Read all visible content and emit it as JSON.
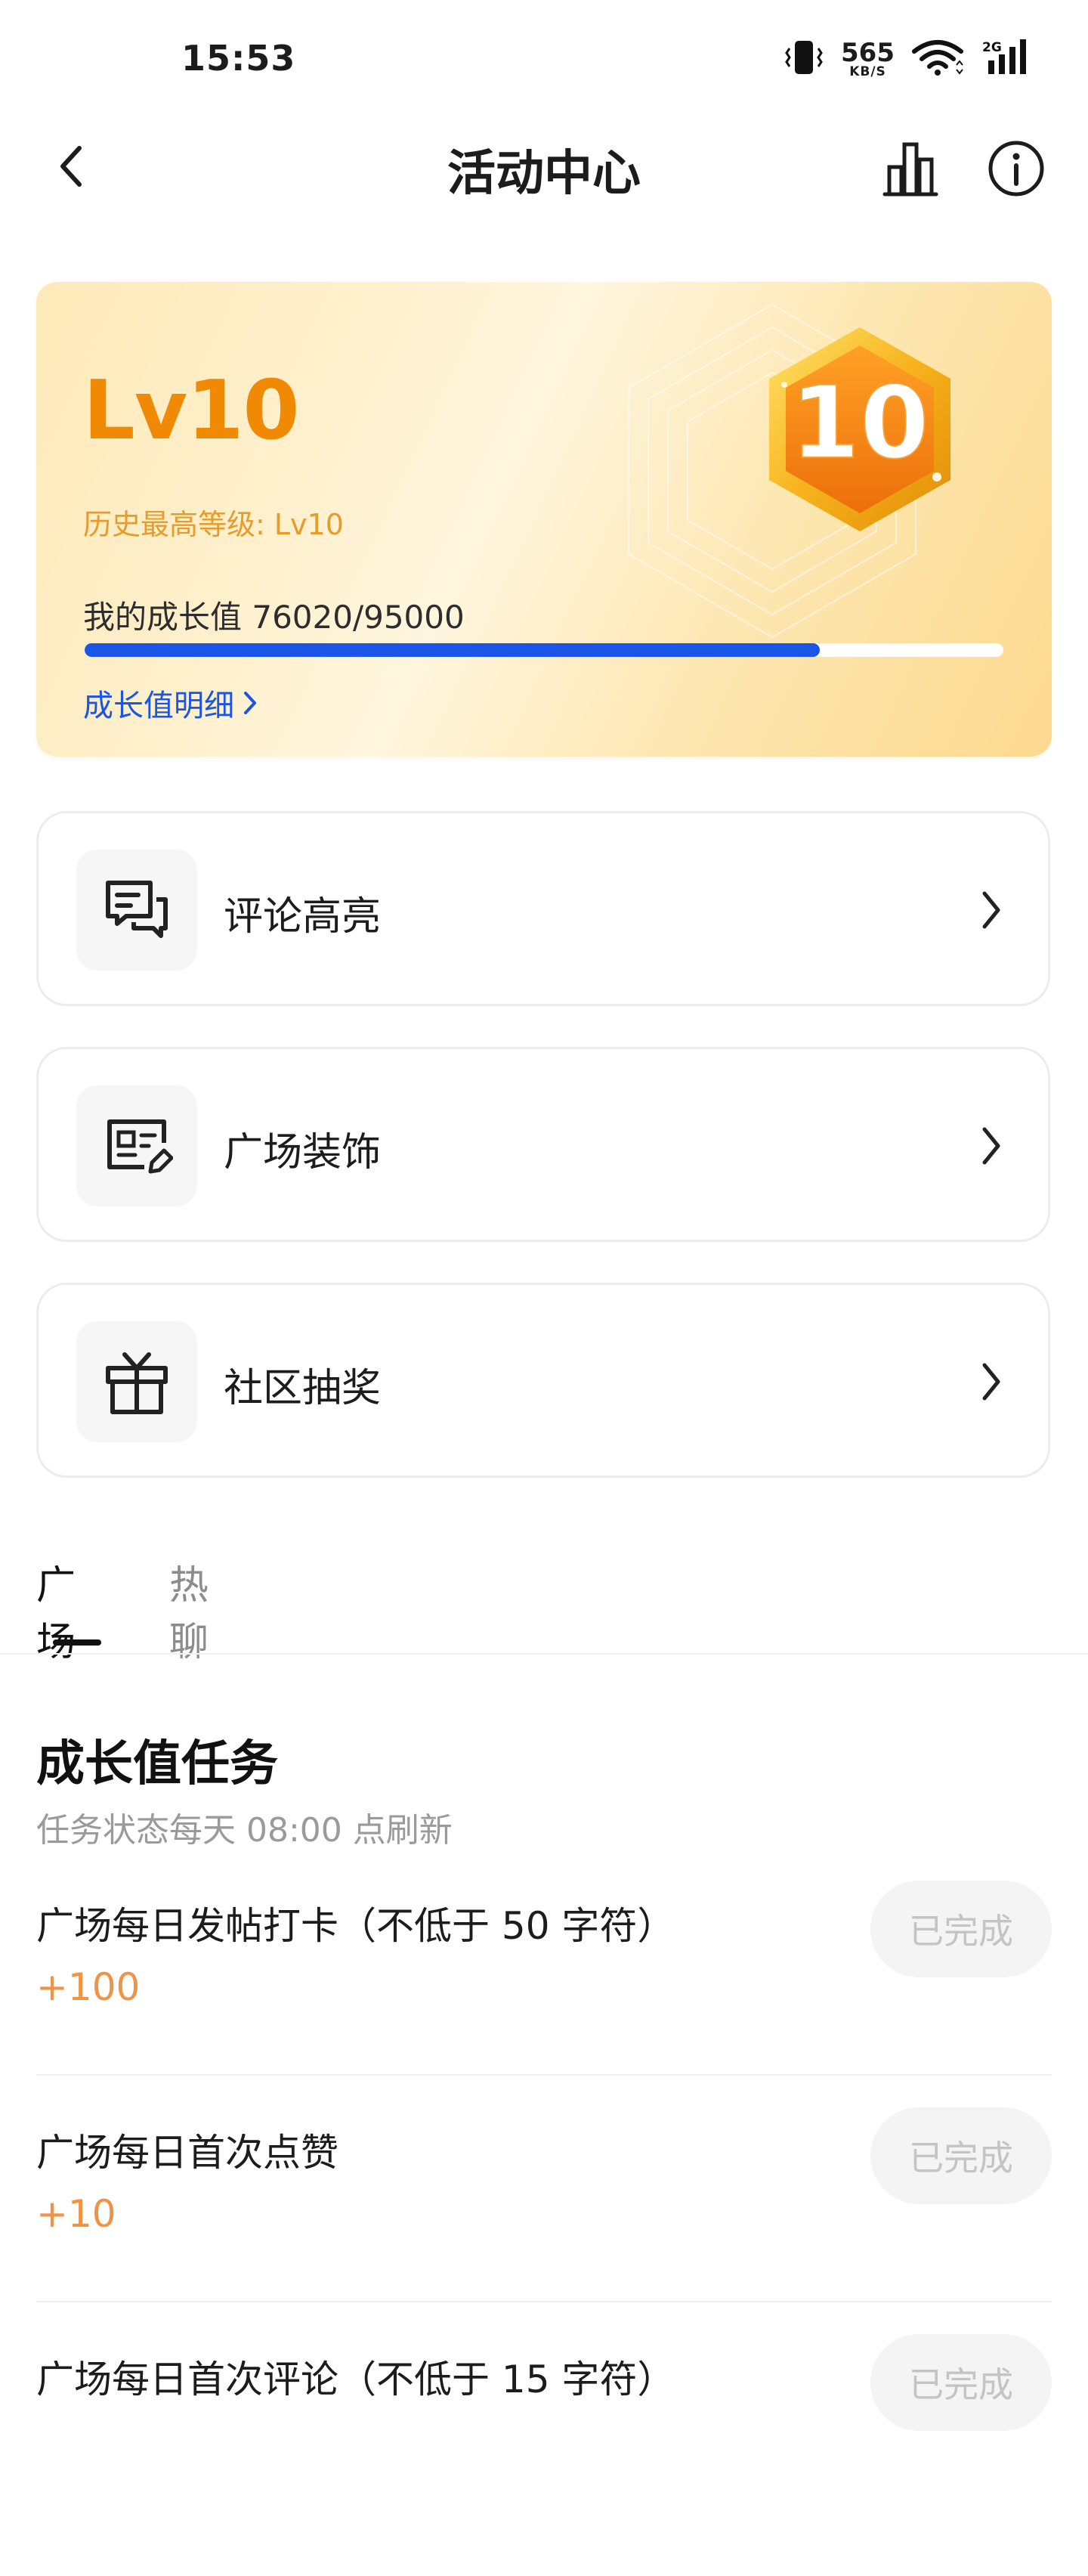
{
  "status_bar": {
    "time": "15:53",
    "net_speed_value": "565",
    "net_speed_unit": "KB/S",
    "signal_label": "2G",
    "icons": [
      "vibrate-icon",
      "wifi-icon",
      "cellular-signal-icon"
    ]
  },
  "header": {
    "title": "活动中心",
    "back_icon": "chevron-left-icon",
    "rank_icon": "bar-chart-icon",
    "info_icon": "info-circle-icon"
  },
  "level_card": {
    "level": "Lv10",
    "badge_number": "10",
    "history_level": "历史最高等级: Lv10",
    "growth_value_text": "我的成长值 76020/95000",
    "growth_current": 76020,
    "growth_max": 95000,
    "progress_fraction": 0.8,
    "detail_link": "成长值明细",
    "accent_color": "#f08a05",
    "progress_color": "#1a55e8"
  },
  "entries": [
    {
      "label": "评论高亮",
      "icon": "comment-highlight-icon"
    },
    {
      "label": "广场装饰",
      "icon": "profile-card-edit-icon"
    },
    {
      "label": "社区抽奖",
      "icon": "gift-icon"
    }
  ],
  "tabs": [
    {
      "label": "广场",
      "active": true
    },
    {
      "label": "热聊",
      "active": false
    }
  ],
  "tasks_section": {
    "title": "成长值任务",
    "subtitle": "任务状态每天 08:00 点刷新",
    "tasks": [
      {
        "title": "广场每日发帖打卡（不低于 50 字符）",
        "reward": "+100",
        "status": "已完成"
      },
      {
        "title": "广场每日首次点赞",
        "reward": "+10",
        "status": "已完成"
      },
      {
        "title": "广场每日首次评论（不低于 15 字符）",
        "reward": "",
        "status": "已完成"
      }
    ]
  }
}
